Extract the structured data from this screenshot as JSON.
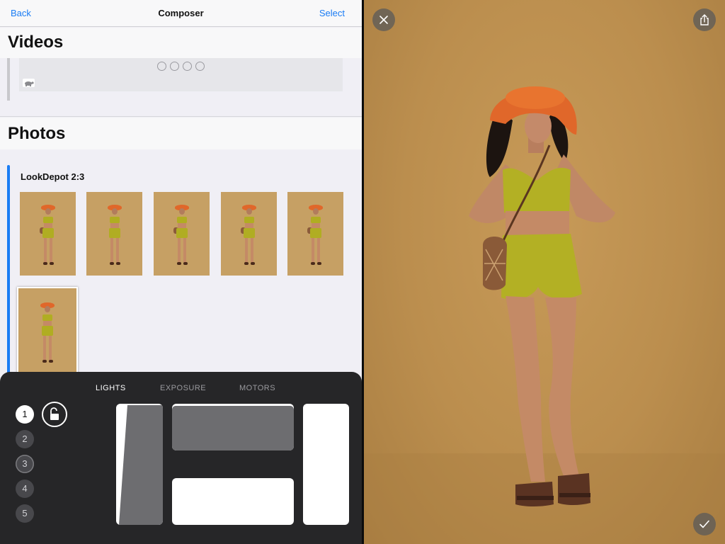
{
  "navbar": {
    "back_label": "Back",
    "title": "Composer",
    "select_label": "Select"
  },
  "videos": {
    "header": "Videos",
    "speed_icon": "turtle-icon"
  },
  "photos": {
    "header": "Photos",
    "group_title": "LookDepot 2:3",
    "thumbnail_count": 6,
    "selected_index": 5
  },
  "panel": {
    "tabs": [
      {
        "label": "LIGHTS",
        "active": true
      },
      {
        "label": "EXPOSURE",
        "active": false
      },
      {
        "label": "MOTORS",
        "active": false
      }
    ],
    "numbers": [
      "1",
      "2",
      "3",
      "4",
      "5"
    ],
    "active_number": "1",
    "lock_icon": "unlock-icon"
  },
  "viewer": {
    "close_icon": "close-icon",
    "share_icon": "share-icon",
    "confirm_icon": "checkmark-icon"
  },
  "colors": {
    "accent": "#1a7cf4",
    "panel_bg": "#262628",
    "backdrop": "#c79a58",
    "hat": "#e0672a",
    "outfit": "#b0ad22"
  }
}
